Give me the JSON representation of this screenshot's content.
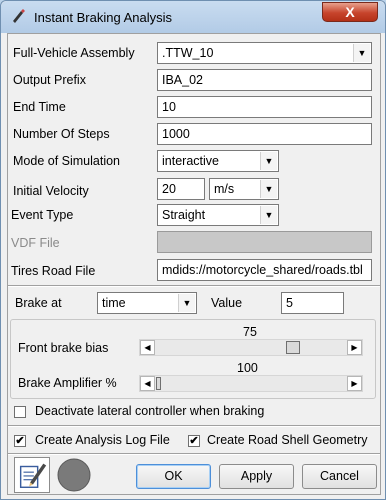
{
  "window": {
    "title": "Instant Braking Analysis",
    "close_label": "X"
  },
  "form": {
    "assembly": {
      "label": "Full-Vehicle Assembly",
      "value": ".TTW_10"
    },
    "output_prefix": {
      "label": "Output Prefix",
      "value": "IBA_02"
    },
    "end_time": {
      "label": "End Time",
      "value": "10"
    },
    "steps": {
      "label": "Number Of Steps",
      "value": "1000"
    },
    "mode": {
      "label": "Mode of Simulation",
      "value": "interactive"
    },
    "velocity": {
      "label": "Initial Velocity",
      "value": "20",
      "unit": "m/s"
    },
    "event": {
      "label": "Event Type",
      "value": "Straight"
    },
    "vdf": {
      "label": "VDF File",
      "value": ""
    },
    "tires": {
      "label": "Tires Road File",
      "value": "mdids://motorcycle_shared/roads.tbl"
    }
  },
  "brake": {
    "at_label": "Brake at",
    "at_value": "time",
    "value_label": "Value",
    "value": "5",
    "front_bias": {
      "label": "Front brake bias",
      "value": "75",
      "fraction": 0.75
    },
    "amplifier": {
      "label": "Brake Amplifier %",
      "value": "100",
      "fraction": 0.0
    }
  },
  "options": {
    "deactivate_lateral": {
      "label": "Deactivate lateral controller when braking",
      "checked": false
    },
    "log_file": {
      "label": "Create Analysis Log File",
      "checked": true
    },
    "road_shell": {
      "label": "Create Road Shell Geometry",
      "checked": true
    }
  },
  "buttons": {
    "ok": "OK",
    "apply": "Apply",
    "cancel": "Cancel"
  },
  "icons": [
    "edit-document-icon",
    "stop-circle-icon"
  ]
}
